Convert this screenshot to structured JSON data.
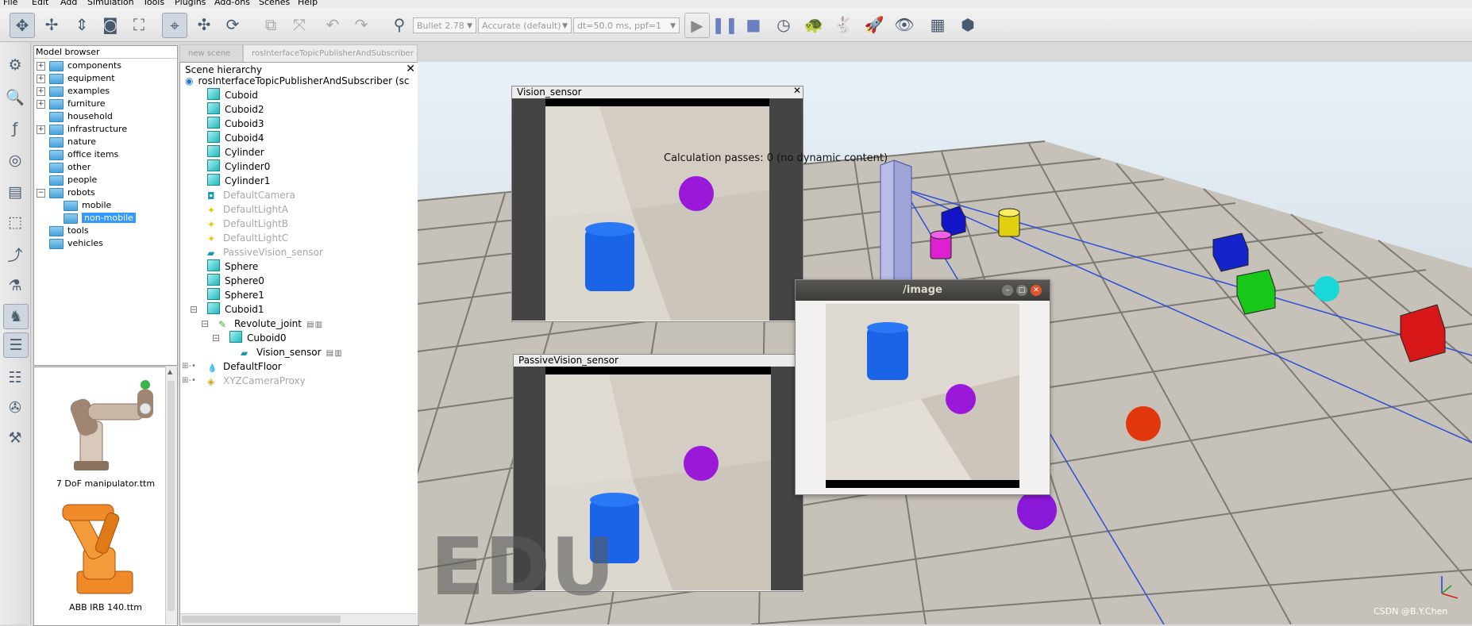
{
  "menubar": [
    "File",
    "Edit",
    "Add",
    "Simulation",
    "Tools",
    "Plugins",
    "Add-ons",
    "Scenes",
    "Help"
  ],
  "toolbar": {
    "engine": "Bullet 2.78",
    "accuracy": "Accurate (default)",
    "timestep": "dt=50.0 ms, ppf=1"
  },
  "model_browser": {
    "title": "Model browser",
    "items": [
      {
        "label": "components",
        "expander": "+"
      },
      {
        "label": "equipment",
        "expander": "+"
      },
      {
        "label": "examples",
        "expander": "+"
      },
      {
        "label": "furniture",
        "expander": "+"
      },
      {
        "label": "household",
        "expander": ""
      },
      {
        "label": "infrastructure",
        "expander": "+"
      },
      {
        "label": "nature",
        "expander": ""
      },
      {
        "label": "office items",
        "expander": ""
      },
      {
        "label": "other",
        "expander": ""
      },
      {
        "label": "people",
        "expander": ""
      },
      {
        "label": "robots",
        "expander": "−"
      },
      {
        "label": "mobile",
        "expander": ""
      },
      {
        "label": "non-mobile",
        "expander": ""
      },
      {
        "label": "tools",
        "expander": ""
      },
      {
        "label": "vehicles",
        "expander": ""
      }
    ],
    "thumbnails": [
      {
        "caption": "7 DoF manipulator.ttm"
      },
      {
        "caption": "ABB IRB 140.ttm"
      }
    ]
  },
  "tabs": [
    "new scene",
    "rosInterfaceTopicPublisherAndSubscriber"
  ],
  "scene_hierarchy": {
    "title": "Scene hierarchy",
    "root": "rosInterfaceTopicPublisherAndSubscriber (sc",
    "items": [
      {
        "label": "Cuboid",
        "kind": "shape"
      },
      {
        "label": "Cuboid2",
        "kind": "shape"
      },
      {
        "label": "Cuboid3",
        "kind": "shape"
      },
      {
        "label": "Cuboid4",
        "kind": "shape"
      },
      {
        "label": "Cylinder",
        "kind": "shape"
      },
      {
        "label": "Cylinder0",
        "kind": "shape"
      },
      {
        "label": "Cylinder1",
        "kind": "shape"
      },
      {
        "label": "DefaultCamera",
        "kind": "camera"
      },
      {
        "label": "DefaultLightA",
        "kind": "light"
      },
      {
        "label": "DefaultLightB",
        "kind": "light"
      },
      {
        "label": "DefaultLightC",
        "kind": "light"
      },
      {
        "label": "PassiveVision_sensor",
        "kind": "sensor"
      },
      {
        "label": "Sphere",
        "kind": "shape"
      },
      {
        "label": "Sphere0",
        "kind": "shape"
      },
      {
        "label": "Sphere1",
        "kind": "shape"
      },
      {
        "label": "Cuboid1",
        "kind": "shape"
      },
      {
        "label": "Revolute_joint",
        "kind": "joint"
      },
      {
        "label": "Cuboid0",
        "kind": "shape"
      },
      {
        "label": "Vision_sensor",
        "kind": "sensor"
      },
      {
        "label": "DefaultFloor",
        "kind": "floor"
      },
      {
        "label": "XYZCameraProxy",
        "kind": "proxy"
      }
    ]
  },
  "viewport": {
    "calc_text": "Calculation passes: 0 (no dynamic content)",
    "watermark": "EDU",
    "credit": "CSDN @B.Y.Chen"
  },
  "floating_views": {
    "vision": "Vision_sensor",
    "passive": "PassiveVision_sensor",
    "image": "/image"
  }
}
